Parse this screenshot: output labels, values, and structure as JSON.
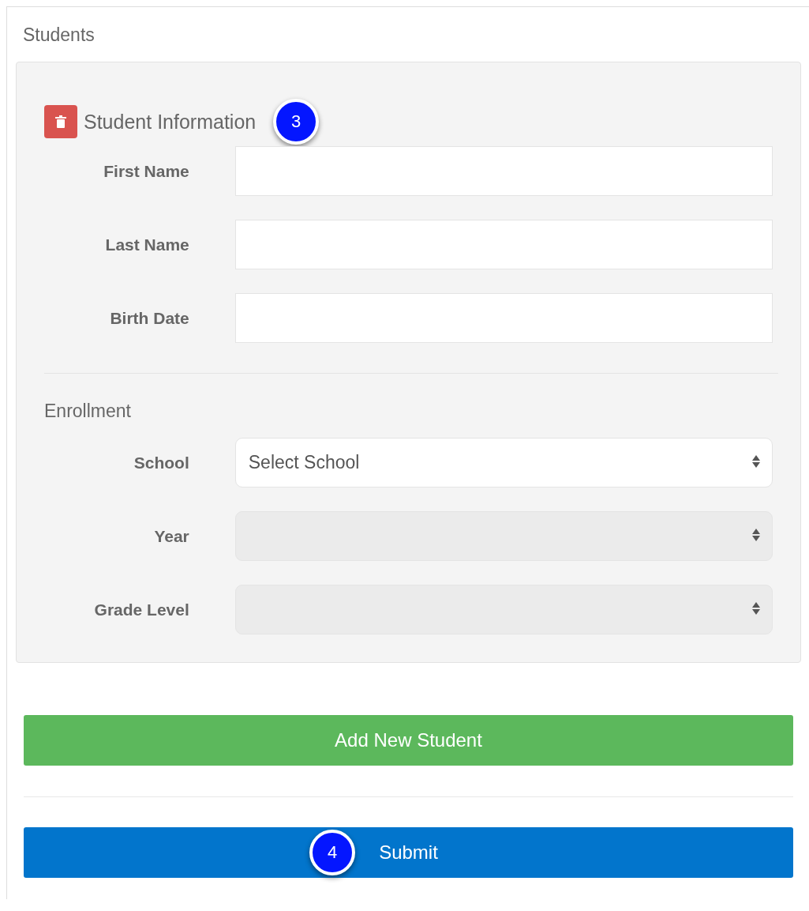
{
  "section": {
    "title": "Students"
  },
  "student_panel": {
    "title": "Student Information",
    "callout": "3",
    "fields": [
      {
        "label": "First Name",
        "kind": "input",
        "disabled": false
      },
      {
        "label": "Last Name",
        "kind": "input",
        "disabled": false
      },
      {
        "label": "Birth Date",
        "kind": "input",
        "disabled": false
      }
    ],
    "enrollment": {
      "title": "Enrollment",
      "fields": [
        {
          "label": "School",
          "kind": "select",
          "value": "Select School",
          "disabled": false
        },
        {
          "label": "Year",
          "kind": "select",
          "disabled": true
        },
        {
          "label": "Grade Level",
          "kind": "select",
          "disabled": true
        }
      ]
    }
  },
  "buttons": [
    {
      "label": "Add New Student",
      "kind": "success"
    },
    {
      "label": "Submit",
      "kind": "primary",
      "callout": "4"
    }
  ]
}
